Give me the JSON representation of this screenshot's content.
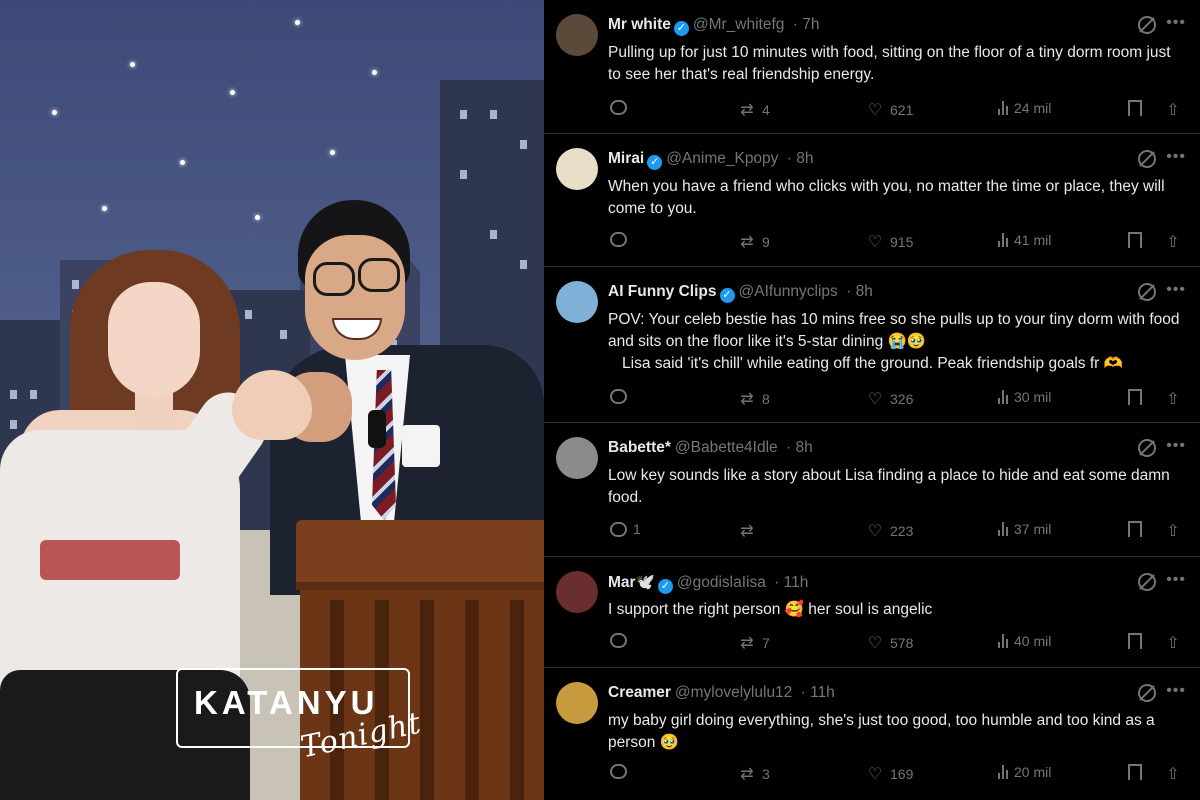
{
  "photo": {
    "logo_main": "KATANYU",
    "logo_sub": "Tonight"
  },
  "feed": {
    "tweets": [
      {
        "name": "Mr white",
        "handle": "@Mr_whitefg",
        "time": "· 7h",
        "text": "Pulling up for just 10 minutes with food, sitting on the floor of a tiny dorm room just to see her  that's real friendship energy.",
        "replies": "",
        "reposts": "4",
        "likes": "621",
        "views": "24 mil",
        "avatar_color": "#5b4a3a"
      },
      {
        "name": "Mirai",
        "handle": "@Anime_Kpopy",
        "time": "· 8h",
        "text": "When you have a friend who clicks with you, no matter the time or place, they will come to you.",
        "replies": "",
        "reposts": "9",
        "likes": "915",
        "views": "41 mil",
        "avatar_color": "#e9dfc8"
      },
      {
        "name": "AI Funny Clips",
        "handle": "@AIfunnyclips",
        "time": "· 8h",
        "text": "POV: Your celeb bestie has 10 mins free so she pulls up to your tiny dorm with food and sits on the floor like it's 5-star dining 😭🥹",
        "text2": "Lisa said 'it's chill' while eating off the ground. Peak friendship goals fr 🫶",
        "replies": "",
        "reposts": "8",
        "likes": "326",
        "views": "30 mil",
        "avatar_color": "#7fb0d8"
      },
      {
        "name": "Babette*",
        "handle": "@Babette4Idle",
        "time": "· 8h",
        "text": "Low key sounds like a story about Lisa finding a place to hide and eat some damn food.",
        "replies": "1",
        "reposts": "",
        "likes": "223",
        "views": "37 mil",
        "avatar_color": "#8b8b8b"
      },
      {
        "name": "Mar🕊️",
        "handle": "@godislaIisa",
        "time": "· 11h",
        "text": "I support the right person  🥰 her soul is angelic",
        "replies": "",
        "reposts": "7",
        "likes": "578",
        "views": "40 mil",
        "avatar_color": "#6a2e2e"
      },
      {
        "name": "Creamer",
        "handle": "@mylovelylulu12",
        "time": "· 11h",
        "text": "my baby girl doing everything, she's just too good, too humble and too kind as a person 🥹",
        "replies": "",
        "reposts": "3",
        "likes": "169",
        "views": "20 mil",
        "avatar_color": "#c79a3e"
      }
    ]
  }
}
